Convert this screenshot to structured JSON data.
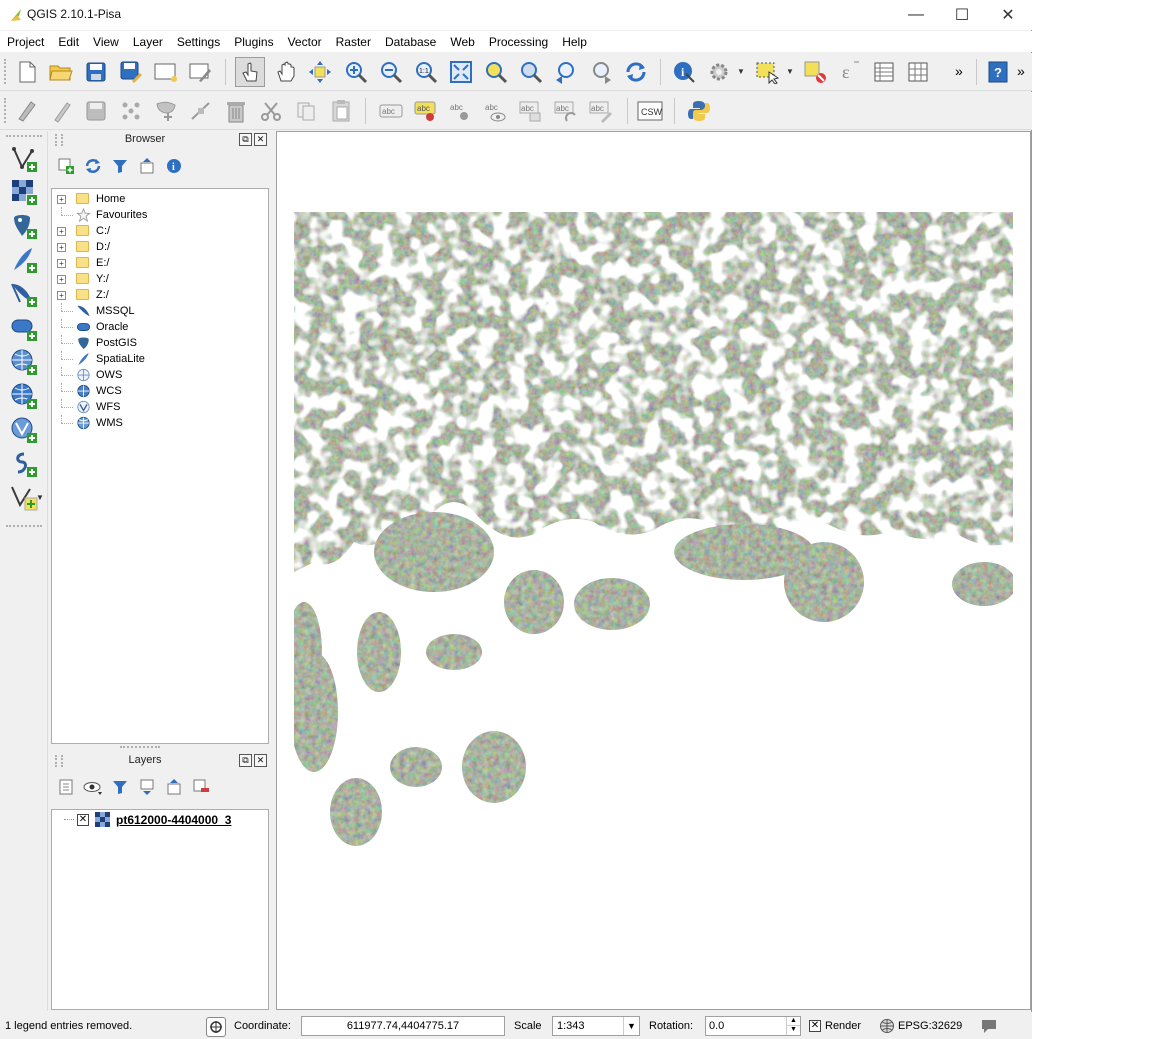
{
  "window": {
    "title": "QGIS 2.10.1-Pisa",
    "min": "—",
    "max": "☐",
    "close": "✕"
  },
  "menubar": [
    "Project",
    "Edit",
    "View",
    "Layer",
    "Settings",
    "Plugins",
    "Vector",
    "Raster",
    "Database",
    "Web",
    "Processing",
    "Help"
  ],
  "toolbar": {
    "overflow": "»",
    "overflow2": "»",
    "csw": "CSW",
    "abc": "abc"
  },
  "browser": {
    "title": "Browser",
    "items": [
      {
        "label": "Home",
        "expandable": true,
        "icon": "folder-icon"
      },
      {
        "label": "Favourites",
        "expandable": false,
        "icon": "star-icon"
      },
      {
        "label": "C:/",
        "expandable": true,
        "icon": "folder-icon"
      },
      {
        "label": "D:/",
        "expandable": true,
        "icon": "folder-icon"
      },
      {
        "label": "E:/",
        "expandable": true,
        "icon": "folder-icon"
      },
      {
        "label": "Y:/",
        "expandable": true,
        "icon": "folder-icon"
      },
      {
        "label": "Z:/",
        "expandable": true,
        "icon": "folder-icon"
      },
      {
        "label": "MSSQL",
        "expandable": false,
        "icon": "mssql-icon"
      },
      {
        "label": "Oracle",
        "expandable": false,
        "icon": "oracle-icon"
      },
      {
        "label": "PostGIS",
        "expandable": false,
        "icon": "postgis-icon"
      },
      {
        "label": "SpatiaLite",
        "expandable": false,
        "icon": "spatialite-icon"
      },
      {
        "label": "OWS",
        "expandable": false,
        "icon": "ows-icon"
      },
      {
        "label": "WCS",
        "expandable": false,
        "icon": "wcs-icon"
      },
      {
        "label": "WFS",
        "expandable": false,
        "icon": "wfs-icon"
      },
      {
        "label": "WMS",
        "expandable": false,
        "icon": "wms-icon"
      }
    ]
  },
  "layers": {
    "title": "Layers",
    "items": [
      {
        "label": "pt612000-4404000_3",
        "checked": true,
        "icon": "raster-layer-icon"
      }
    ]
  },
  "dock_buttons": {
    "float": "⧉",
    "close": "✕"
  },
  "statusbar": {
    "message": "1 legend entries removed.",
    "coordinate_label": "Coordinate:",
    "coordinate_value": "611977.74,4404775.17",
    "scale_label": "Scale",
    "scale_value": "1:343",
    "rotation_label": "Rotation:",
    "rotation_value": "0.0",
    "render_label": "Render",
    "render_checked": "✕",
    "crs": "EPSG:32629"
  },
  "colors": {
    "accent": "#2f6fc0",
    "foliage": "#7f9476",
    "plus": "#2e9b2e"
  }
}
